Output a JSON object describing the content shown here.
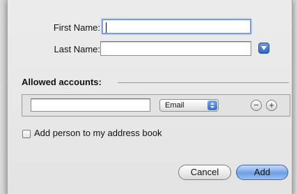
{
  "form": {
    "first_name_label": "First Name:",
    "first_name_value": "",
    "last_name_label": "Last Name:",
    "last_name_value": ""
  },
  "accounts": {
    "section_title": "Allowed accounts:",
    "account_value": "",
    "type_selected": "Email",
    "remove_symbol": "−",
    "add_symbol": "+"
  },
  "options": {
    "add_to_address_book_label": "Add person to my address book",
    "add_to_address_book_checked": false
  },
  "buttons": {
    "cancel": "Cancel",
    "add": "Add"
  },
  "colors": {
    "accent": "#3370cf",
    "focus_ring": "#7ba0d8"
  }
}
